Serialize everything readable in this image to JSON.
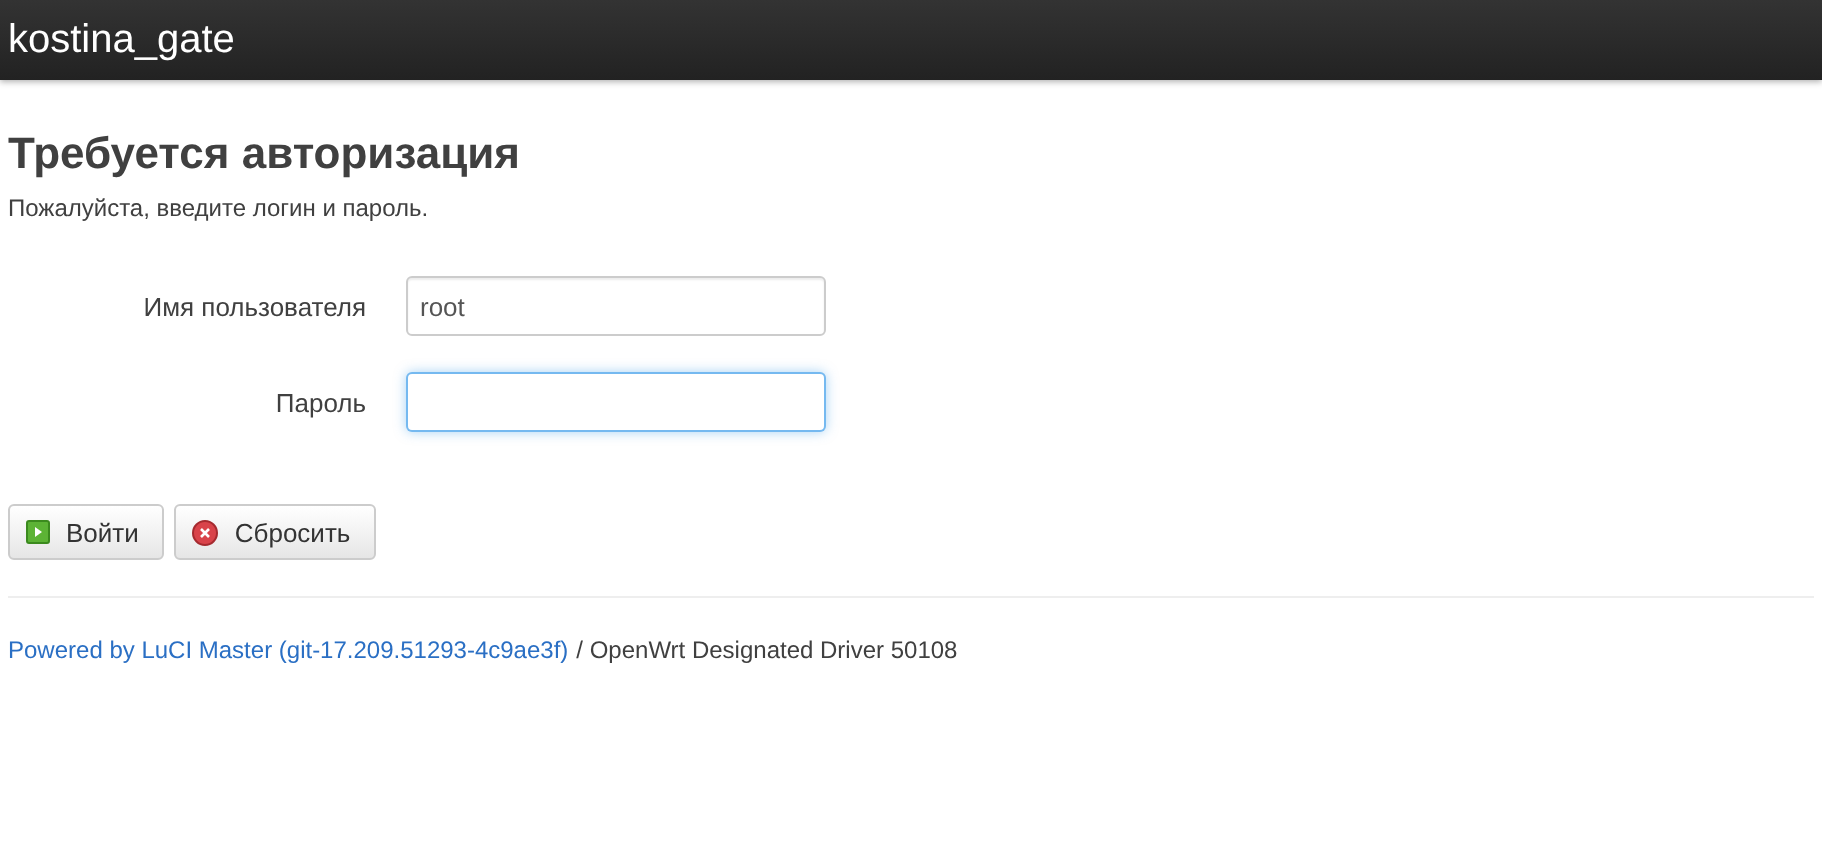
{
  "header": {
    "title": "kostina_gate"
  },
  "heading": "Требуется авторизация",
  "description": "Пожалуйста, введите логин и пароль.",
  "fields": [
    {
      "label": "Имя пользователя",
      "value": "root",
      "focused": false,
      "kind": "text"
    },
    {
      "label": "Пароль",
      "focused": true,
      "kind": "password"
    }
  ],
  "buttons": [
    {
      "label": "Войти",
      "kind": "login"
    },
    {
      "label": "Сбросить",
      "kind": "reset"
    }
  ],
  "footer": {
    "link": "Powered by LuCI Master (git-17.209.51293-4c9ae3f)",
    "text": "/ OpenWrt Designated Driver 50108"
  }
}
